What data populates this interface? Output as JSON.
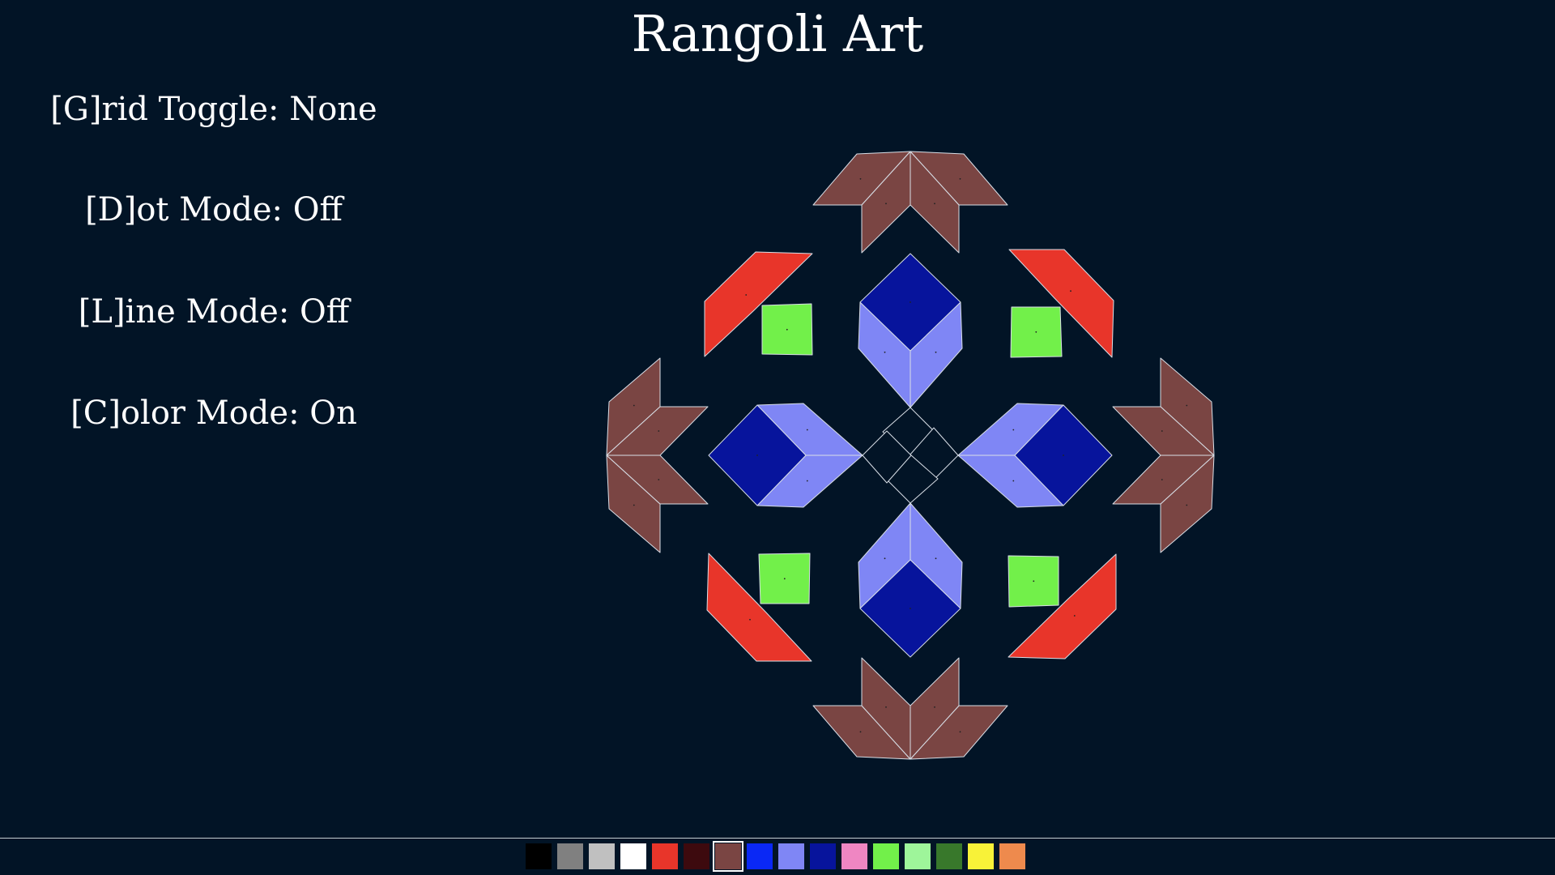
{
  "app": {
    "title": "Rangoli Art"
  },
  "status": {
    "grid": "[G]rid Toggle: None",
    "dot": "[D]ot Mode: Off",
    "line": "[L]ine Mode: Off",
    "color": "[C]olor Mode: On"
  },
  "theme": {
    "background": "#021426",
    "outline": "#d8dee6"
  },
  "palette": {
    "selected_index": 6,
    "colors": [
      {
        "name": "black",
        "hex": "#000000"
      },
      {
        "name": "gray",
        "hex": "#808080"
      },
      {
        "name": "light-gray",
        "hex": "#c0c0c0"
      },
      {
        "name": "white",
        "hex": "#ffffff"
      },
      {
        "name": "red",
        "hex": "#e8352a"
      },
      {
        "name": "dark-maroon",
        "hex": "#3d0a0e"
      },
      {
        "name": "brown",
        "hex": "#7a4543"
      },
      {
        "name": "blue",
        "hex": "#0a28f5"
      },
      {
        "name": "periwinkle",
        "hex": "#7f86f5"
      },
      {
        "name": "navy",
        "hex": "#07149c"
      },
      {
        "name": "pink",
        "hex": "#ef86c2"
      },
      {
        "name": "green",
        "hex": "#72f04a"
      },
      {
        "name": "light-green",
        "hex": "#9ef59a"
      },
      {
        "name": "dark-green",
        "hex": "#38782b"
      },
      {
        "name": "yellow",
        "hex": "#f8f238"
      },
      {
        "name": "orange",
        "hex": "#ee8a4d"
      }
    ]
  },
  "artwork": {
    "fill_colors": {
      "brown": "#7a4543",
      "red": "#e8352a",
      "green": "#72f04a",
      "navy": "#07149c",
      "periwinkle": "#7f86f5",
      "empty": "#021426"
    }
  }
}
